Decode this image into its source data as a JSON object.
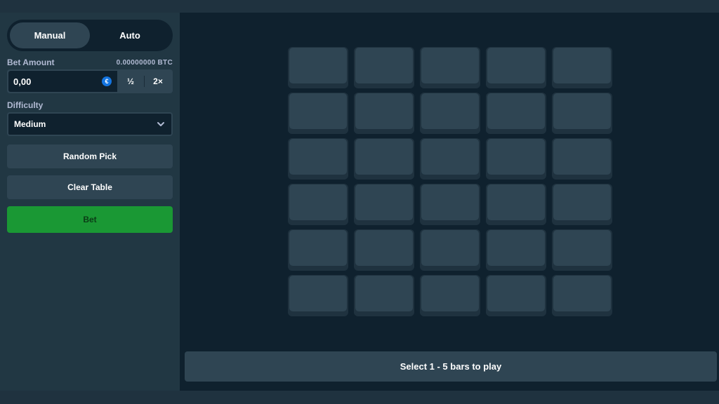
{
  "controls": {
    "modes": [
      "Manual",
      "Auto"
    ],
    "active_mode": "Manual",
    "bet_amount_label": "Bet Amount",
    "bet_balance": "0.00000000 BTC",
    "bet_value": "0,00",
    "coin_icon": "euro-coin-icon",
    "half_label": "½",
    "double_label": "2×",
    "difficulty_label": "Difficulty",
    "difficulty_value": "Medium",
    "random_pick_label": "Random Pick",
    "clear_table_label": "Clear Table",
    "bet_label": "Bet"
  },
  "board": {
    "columns": 5,
    "rows": 6,
    "status_text": "Select 1 - 5 bars to play"
  },
  "colors": {
    "sidebar": "#213743",
    "board": "#0f212e",
    "tile": "#2f4553",
    "bet_button": "#1a9834",
    "coin": "#1475e1"
  }
}
